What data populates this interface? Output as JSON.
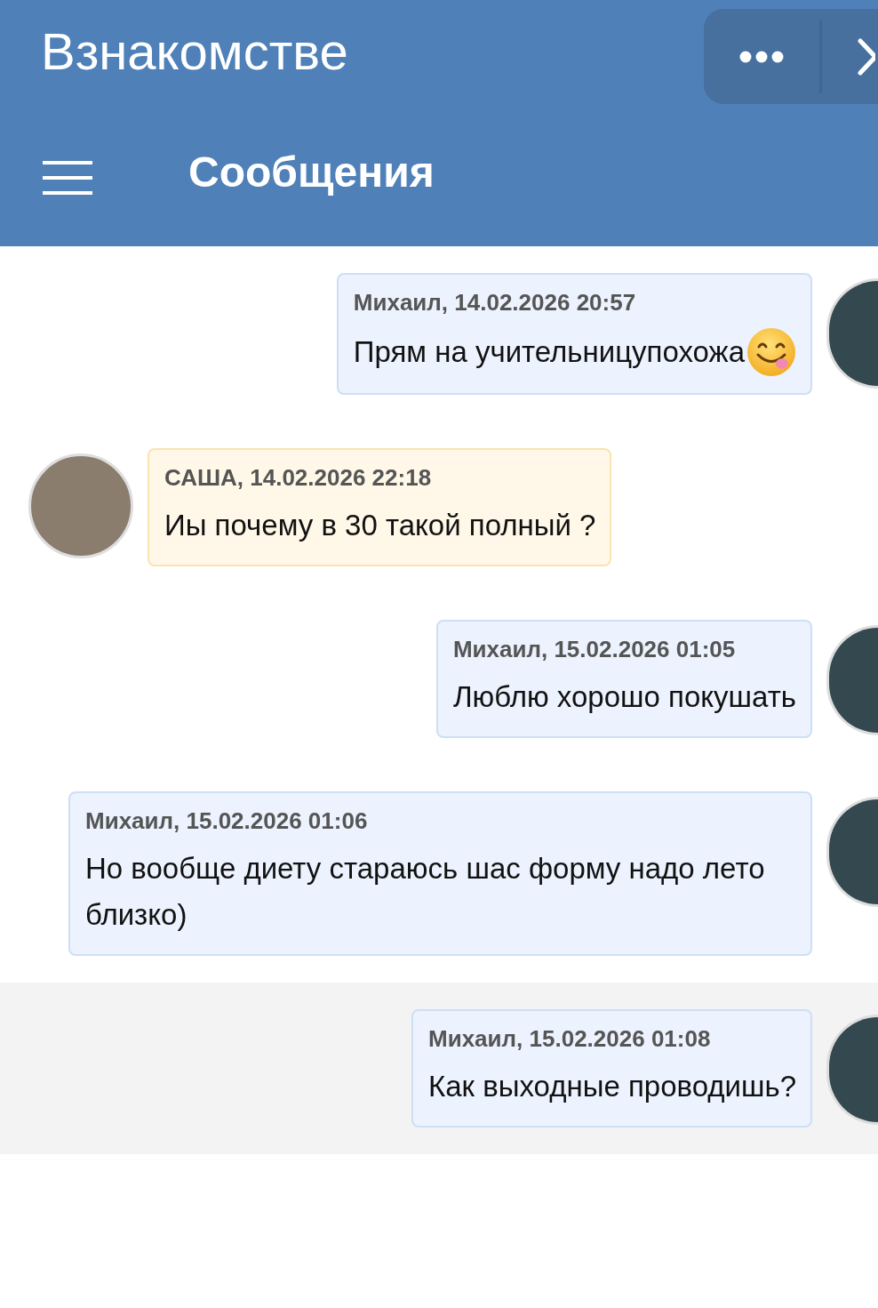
{
  "header": {
    "title": "Взнакомстве",
    "section": "Сообщения"
  },
  "messages": [
    {
      "kind": "outgoing",
      "author": "Михаил, 14.02.2026 20:57",
      "text": "Прям на учительницупохожа",
      "emoji": true,
      "highlighted": false
    },
    {
      "kind": "incoming",
      "author": "САША, 14.02.2026 22:18",
      "text": "Иы почему в 30 такой полный ?",
      "emoji": false,
      "highlighted": false
    },
    {
      "kind": "outgoing",
      "author": "Михаил, 15.02.2026 01:05",
      "text": "Люблю хорошо покушать",
      "emoji": false,
      "highlighted": false
    },
    {
      "kind": "outgoing",
      "author": "Михаил, 15.02.2026 01:06",
      "text": "Но вообще диету стараюсь шас форму надо лето близко)",
      "emoji": false,
      "highlighted": false
    },
    {
      "kind": "outgoing",
      "author": "Михаил, 15.02.2026 01:08",
      "text": "Как выходные проводишь?",
      "emoji": false,
      "highlighted": true
    }
  ]
}
